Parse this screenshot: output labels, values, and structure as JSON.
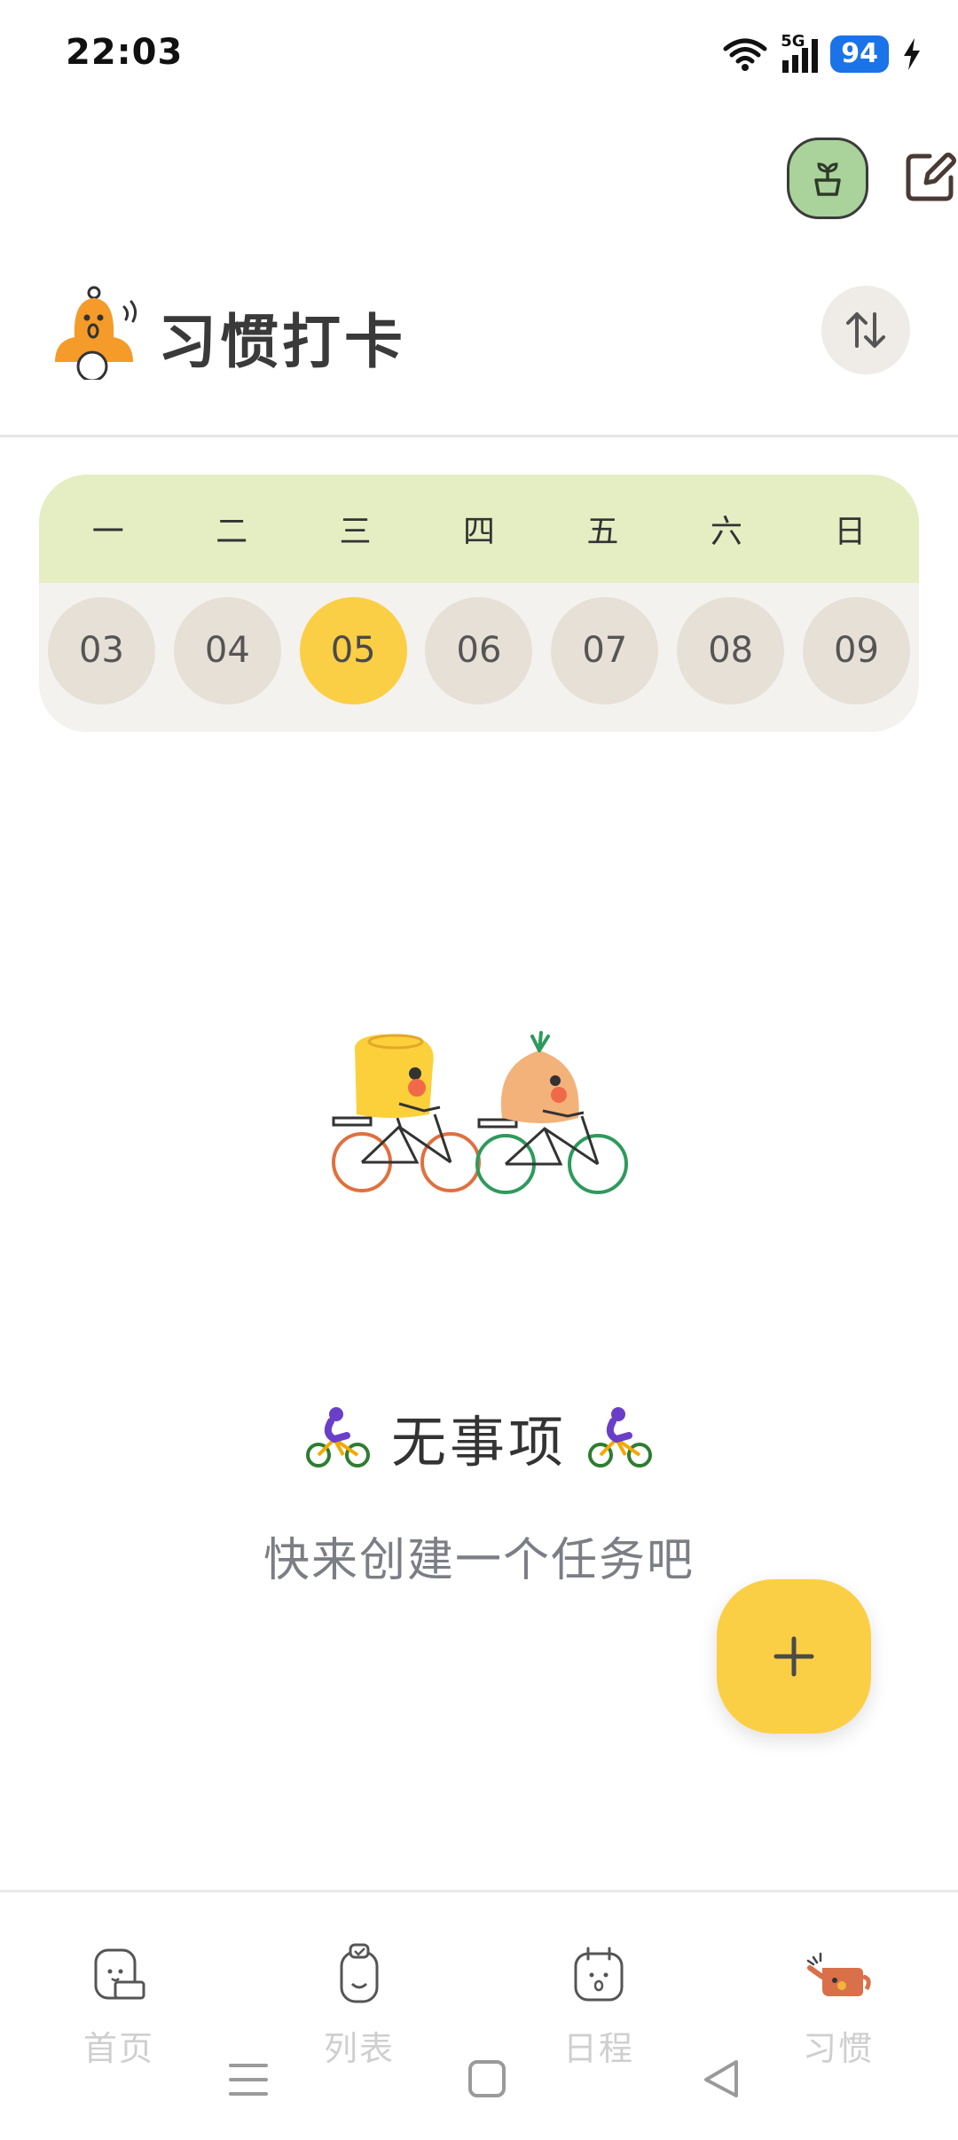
{
  "status_bar": {
    "time": "22:03",
    "network": "5G",
    "battery": "94"
  },
  "header": {
    "title": "习惯打卡"
  },
  "week": {
    "weekdays": [
      "一",
      "二",
      "三",
      "四",
      "五",
      "六",
      "日"
    ],
    "dates": [
      "03",
      "04",
      "05",
      "06",
      "07",
      "08",
      "09"
    ],
    "selected_index": 2
  },
  "empty_state": {
    "title": "无事项",
    "subtitle": "快来创建一个任务吧"
  },
  "bottom_nav": {
    "items": [
      {
        "label": "首页",
        "icon": "home-icon"
      },
      {
        "label": "列表",
        "icon": "list-icon"
      },
      {
        "label": "日程",
        "icon": "calendar-icon"
      },
      {
        "label": "习惯",
        "icon": "habit-icon"
      }
    ],
    "active_index": 3
  },
  "colors": {
    "accent_yellow": "#fbcf45",
    "weekday_bg": "#e5eec3",
    "plant_green": "#a9d39a"
  }
}
